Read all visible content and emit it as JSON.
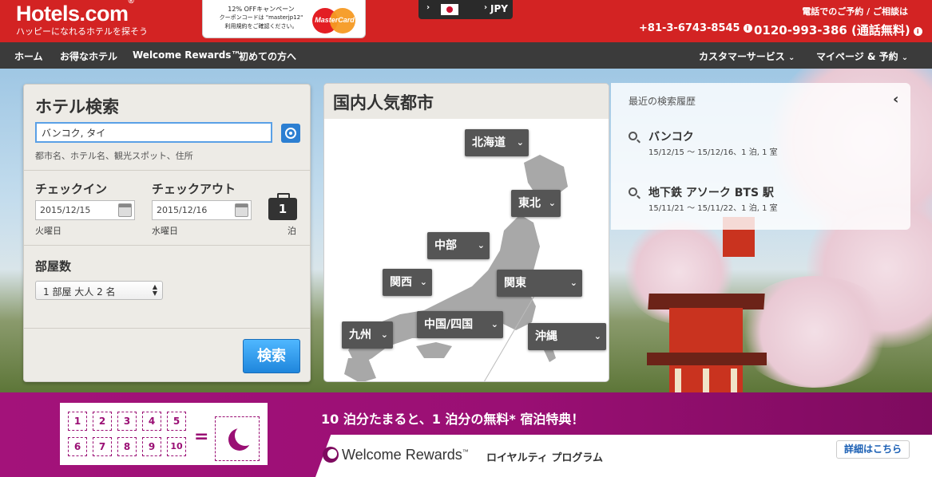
{
  "header": {
    "logo_text": "Hotels.com",
    "logo_mark": "®",
    "tagline": "ハッピーになれるホテルを探そう",
    "promo": {
      "line1": "12% OFFキャンペーン",
      "line2": "クーポンコードは \"masterjp12\"",
      "line3": "利用規約をご確認ください。",
      "card_brand": "MasterCard"
    },
    "currency": {
      "flag_icon": "japan-flag-icon",
      "code": "JPY"
    },
    "contact_label": "電話でのご予約 / ご相談は",
    "phone_intl": "+81-3-6743-8545",
    "phone_free": "0120-993-386 (通話無料)",
    "info_glyph": "i"
  },
  "nav": {
    "items": [
      "ホーム",
      "お得なホテル",
      "Welcome Rewards™",
      "初めての方へ"
    ],
    "right": [
      "カスタマーサービス",
      "マイページ & 予約"
    ]
  },
  "search": {
    "title": "ホテル検索",
    "destination_value": "バンコク, タイ",
    "destination_hint": "都市名、ホテル名、観光スポット、住所",
    "checkin_label": "チェックイン",
    "checkout_label": "チェックアウト",
    "checkin_value": "2015/12/15",
    "checkout_value": "2015/12/16",
    "checkin_weekday": "火曜日",
    "checkout_weekday": "水曜日",
    "nights": "1",
    "nights_label": "泊",
    "rooms_label": "部屋数",
    "rooms_value": "1 部屋 大人 2 名",
    "search_button": "検索"
  },
  "map": {
    "title": "国内人気都市",
    "regions": [
      "北海道",
      "東北",
      "中部",
      "関西",
      "関東",
      "九州",
      "中国/四国",
      "沖縄"
    ]
  },
  "history": {
    "title": "最近の検索履歴",
    "items": [
      {
        "name": "バンコク",
        "dates": "15/12/15 〜 15/12/16、1 泊, 1 室"
      },
      {
        "name": "地下鉄 アソーク BTS 駅",
        "dates": "15/11/21 〜 15/11/22、1 泊, 1 室"
      }
    ]
  },
  "rewards": {
    "stamps": [
      "1",
      "2",
      "3",
      "4",
      "5",
      "6",
      "7",
      "8",
      "9",
      "10"
    ],
    "equals": "=",
    "headline": "10 泊分たまると、1 泊分の無料* 宿泊特典！",
    "brand": "Welcome Rewards",
    "program": "ロイヤルティ プログラム",
    "details_button": "詳細はこちら"
  },
  "colors": {
    "header_red": "#d32323",
    "nav_dark": "#3b3b3b",
    "rewards_purple": "#9a0f74",
    "search_blue": "#1f86dc"
  }
}
